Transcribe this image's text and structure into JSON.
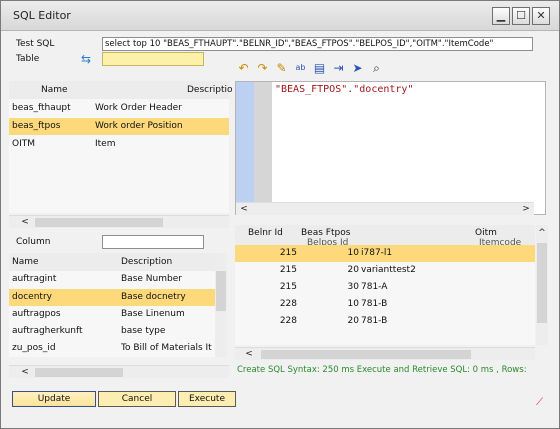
{
  "window": {
    "title": "SQL Editor",
    "minimize": "▁",
    "maximize": "☐",
    "close": "✕"
  },
  "form": {
    "test_sql_label": "Test SQL",
    "test_sql_value": "select top 10 \"BEAS_FTHAUPT\".\"BELNR_ID\",\"BEAS_FTPOS\".\"BELPOS_ID\",\"OITM\".\"ItemCode\"",
    "table_label": "Table",
    "table_value": "",
    "column_label": "Column",
    "column_value": ""
  },
  "tables_grid": {
    "headers": [
      "Name",
      "Descriptio"
    ],
    "rows": [
      {
        "name": "beas_fthaupt",
        "description": "Work Order  Header"
      },
      {
        "name": "beas_ftpos",
        "description": "Work order Position"
      },
      {
        "name": "OITM",
        "description": "Item"
      }
    ],
    "selected_index": 1
  },
  "columns_grid": {
    "headers": [
      "Name",
      "Description"
    ],
    "rows": [
      {
        "name": "auftragint",
        "description": "Base Number"
      },
      {
        "name": "docentry",
        "description": "Base docnetry"
      },
      {
        "name": "auftragpos",
        "description": "Base Linenum"
      },
      {
        "name": "auftragherkunft",
        "description": "base type"
      },
      {
        "name": "zu_pos_id",
        "description": "To Bill of Materials It"
      }
    ],
    "selected_index": 1
  },
  "toolbar": {
    "icons": [
      "undo-icon",
      "redo-icon",
      "format-icon",
      "replace-icon",
      "document-icon",
      "indent-icon",
      "run-icon",
      "search-icon"
    ]
  },
  "editor": {
    "code": "\"BEAS_FTPOS\".\"docentry\""
  },
  "results_grid": {
    "headers": [
      "Belnr Id",
      "Beas Ftpos",
      "Oitm"
    ],
    "subheaders": [
      "Belpos Id",
      "Itemcode"
    ],
    "rows": [
      {
        "belnr": "215",
        "belpos": "10",
        "item": "i787-l1"
      },
      {
        "belnr": "215",
        "belpos": "20",
        "item": "varianttest2"
      },
      {
        "belnr": "215",
        "belpos": "30",
        "item": "781-A"
      },
      {
        "belnr": "228",
        "belpos": "10",
        "item": "781-B"
      },
      {
        "belnr": "228",
        "belpos": "20",
        "item": "781-B"
      }
    ],
    "selected_index": 0
  },
  "status": {
    "text": "Create SQL Syntax: 250 ms   Execute and Retrieve SQL: 0 ms , Rows:"
  },
  "buttons": {
    "update": "Update",
    "cancel": "Cancel",
    "execute": "Execute"
  },
  "colors": {
    "selection": "#fed97c",
    "input_yellow": "#fdf1a9",
    "status_green": "#2b8a2b",
    "code_red": "#a3161b"
  }
}
